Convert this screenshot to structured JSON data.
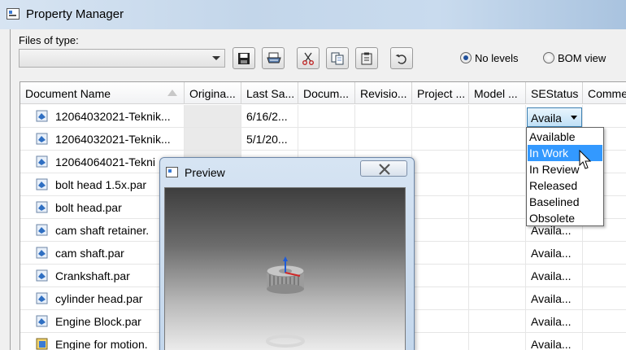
{
  "window": {
    "title": "Property Manager"
  },
  "toolbar": {
    "files_of_type_label": "Files of type:",
    "files_of_type_value": "",
    "buttons": [
      {
        "name": "save-button",
        "icon": "floppy-disk-icon"
      },
      {
        "name": "print-button",
        "icon": "printer-icon"
      },
      {
        "name": "cut-button",
        "icon": "scissors-icon"
      },
      {
        "name": "copy-button",
        "icon": "copy-icon"
      },
      {
        "name": "paste-button",
        "icon": "clipboard-icon"
      },
      {
        "name": "undo-button",
        "icon": "undo-arrow-icon"
      }
    ],
    "view_options": [
      {
        "label": "No levels",
        "selected": true
      },
      {
        "label": "BOM view",
        "selected": false
      }
    ]
  },
  "grid": {
    "columns": [
      "Document Name",
      "Origina...",
      "Last Sa...",
      "Docum...",
      "Revisio...",
      "Project ...",
      "Model ...",
      "SEStatus",
      "Comme"
    ],
    "rows": [
      {
        "name": "12064032021-Teknik...",
        "last_saved": "6/16/2...",
        "status": "Availa",
        "icon": "part-document-icon"
      },
      {
        "name": "12064032021-Teknik...",
        "last_saved": "5/1/20...",
        "status": "",
        "icon": "part-document-icon"
      },
      {
        "name": "12064064021-Tekni",
        "last_saved": "",
        "status": "",
        "icon": "part-document-icon"
      },
      {
        "name": "bolt head 1.5x.par",
        "last_saved": "",
        "status": "",
        "icon": "part-document-icon"
      },
      {
        "name": "bolt head.par",
        "last_saved": "",
        "status": "",
        "icon": "part-document-icon"
      },
      {
        "name": "cam shaft retainer.",
        "last_saved": "",
        "status": "Availa...",
        "icon": "part-document-icon"
      },
      {
        "name": "cam shaft.par",
        "last_saved": "",
        "status": "Availa...",
        "icon": "part-document-icon"
      },
      {
        "name": "Crankshaft.par",
        "last_saved": "",
        "status": "Availa...",
        "icon": "part-document-icon"
      },
      {
        "name": "cylinder head.par",
        "last_saved": "",
        "status": "Availa...",
        "icon": "part-document-icon"
      },
      {
        "name": "Engine Block.par",
        "last_saved": "",
        "status": "Availa...",
        "icon": "part-document-icon"
      },
      {
        "name": "Engine for motion.",
        "last_saved": "",
        "status": "Availa...",
        "icon": "assembly-document-icon"
      }
    ]
  },
  "status_dropdown": {
    "current": "Availa",
    "options": [
      "Available",
      "In Work",
      "In Review",
      "Released",
      "Baselined",
      "Obsolete"
    ],
    "highlighted": "In Work"
  },
  "preview": {
    "title": "Preview"
  }
}
